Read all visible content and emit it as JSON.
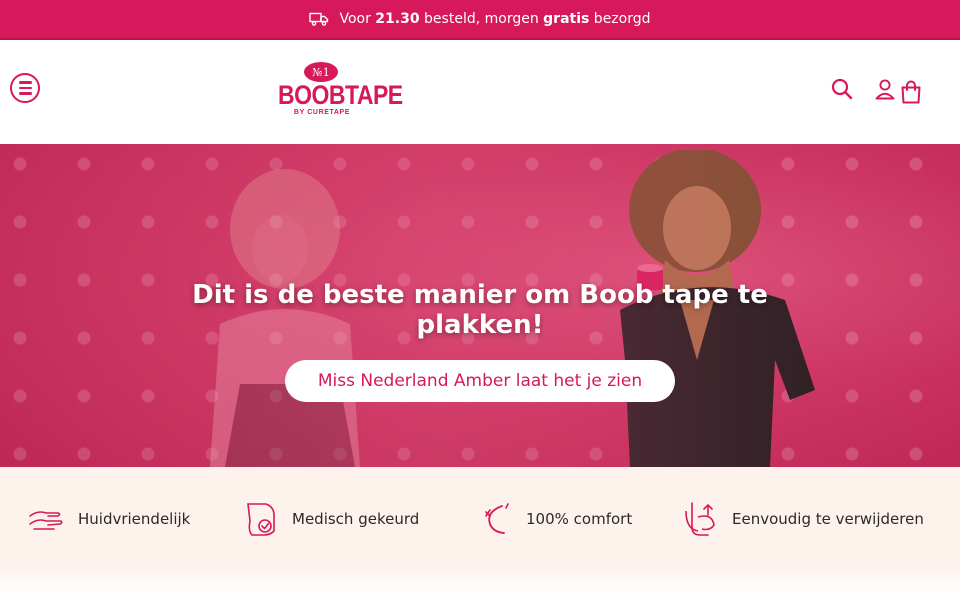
{
  "announcement": {
    "icon": "truck-icon",
    "prefix": "Voor ",
    "time": "21.30",
    "middle": " besteld, morgen ",
    "highlight": "gratis",
    "suffix": " bezorgd"
  },
  "header": {
    "logo": {
      "badge": "№1",
      "name": "BOOBTAPE",
      "sub": "BY CURETAPE"
    },
    "icons": [
      "menu-icon",
      "search-icon",
      "user-icon",
      "shopping-bag-icon"
    ]
  },
  "hero": {
    "title": "Dit is de beste manier om Boob tape te plakken!",
    "cta_label": "Miss Nederland Amber laat het je zien"
  },
  "usps": [
    {
      "icon": "hands-icon",
      "label": "Huidvriendelijk"
    },
    {
      "icon": "skin-check-icon",
      "label": "Medisch gekeurd"
    },
    {
      "icon": "comfort-curve-icon",
      "label": "100% comfort"
    },
    {
      "icon": "peel-off-icon",
      "label": "Eenvoudig te verwijderen"
    }
  ],
  "colors": {
    "brand": "#d7185a",
    "hero_bg": "#c9305f",
    "usp_bg": "#fdf3ec"
  }
}
